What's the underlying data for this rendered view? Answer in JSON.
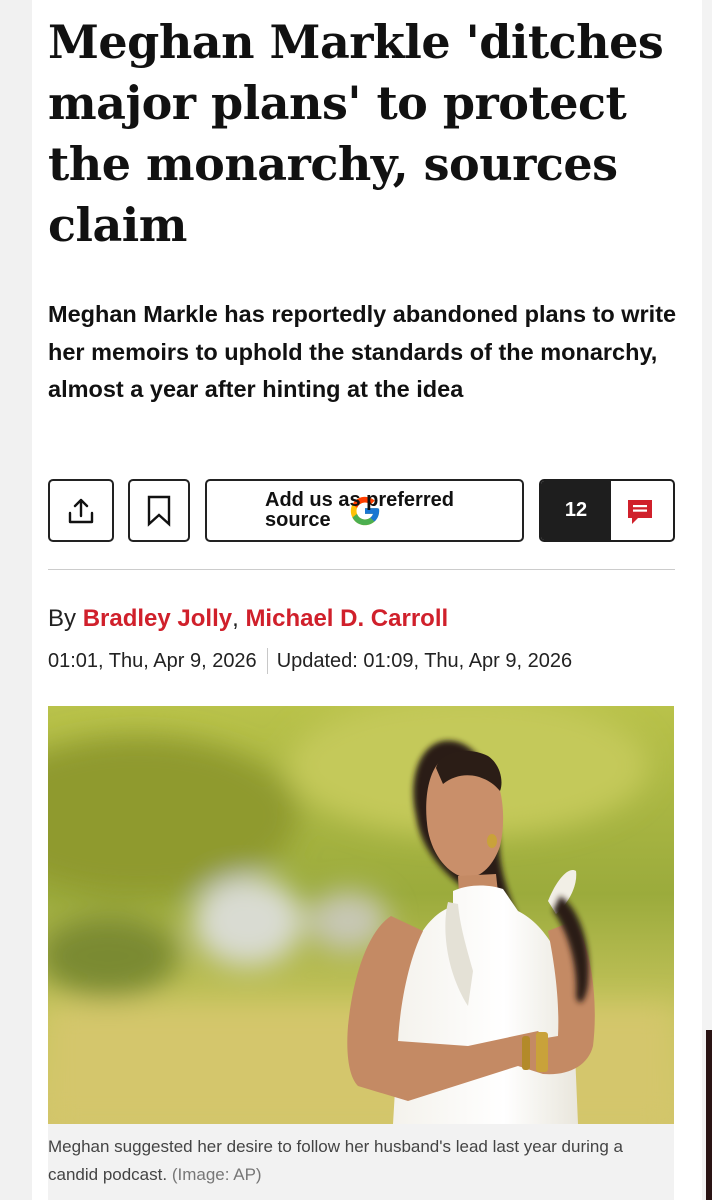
{
  "article": {
    "headline": "Meghan Markle 'ditches major plans' to protect the monarchy, sources claim",
    "standfirst": "Meghan Markle has reportedly abandoned plans to write her memoirs to uphold the standards of the monarchy, almost a year after hinting at the idea",
    "actions": {
      "share_icon": "share-icon",
      "bookmark_icon": "bookmark-icon",
      "source_icon": "google-g-logo",
      "source_label": "Add us as preferred source",
      "comments_count": "12",
      "comments_icon": "comment-bubble-icon"
    },
    "byline": {
      "prefix": "By",
      "author_1": "Bradley Jolly",
      "separator": ",",
      "author_2": "Michael D. Carroll"
    },
    "published": "01:01, Thu, Apr 9, 2026",
    "updated": "Updated: 01:09, Thu, Apr 9, 2026",
    "image": {
      "caption": "Meghan suggested her desire to follow her husband's lead last year during a candid podcast.",
      "credit": "(Image: AP)"
    }
  },
  "colors": {
    "author_link": "#d0202b",
    "comments_count_bg": "#1e1e1e",
    "comments_icon": "#d0202b",
    "caption_bg": "#f2f2f2"
  }
}
